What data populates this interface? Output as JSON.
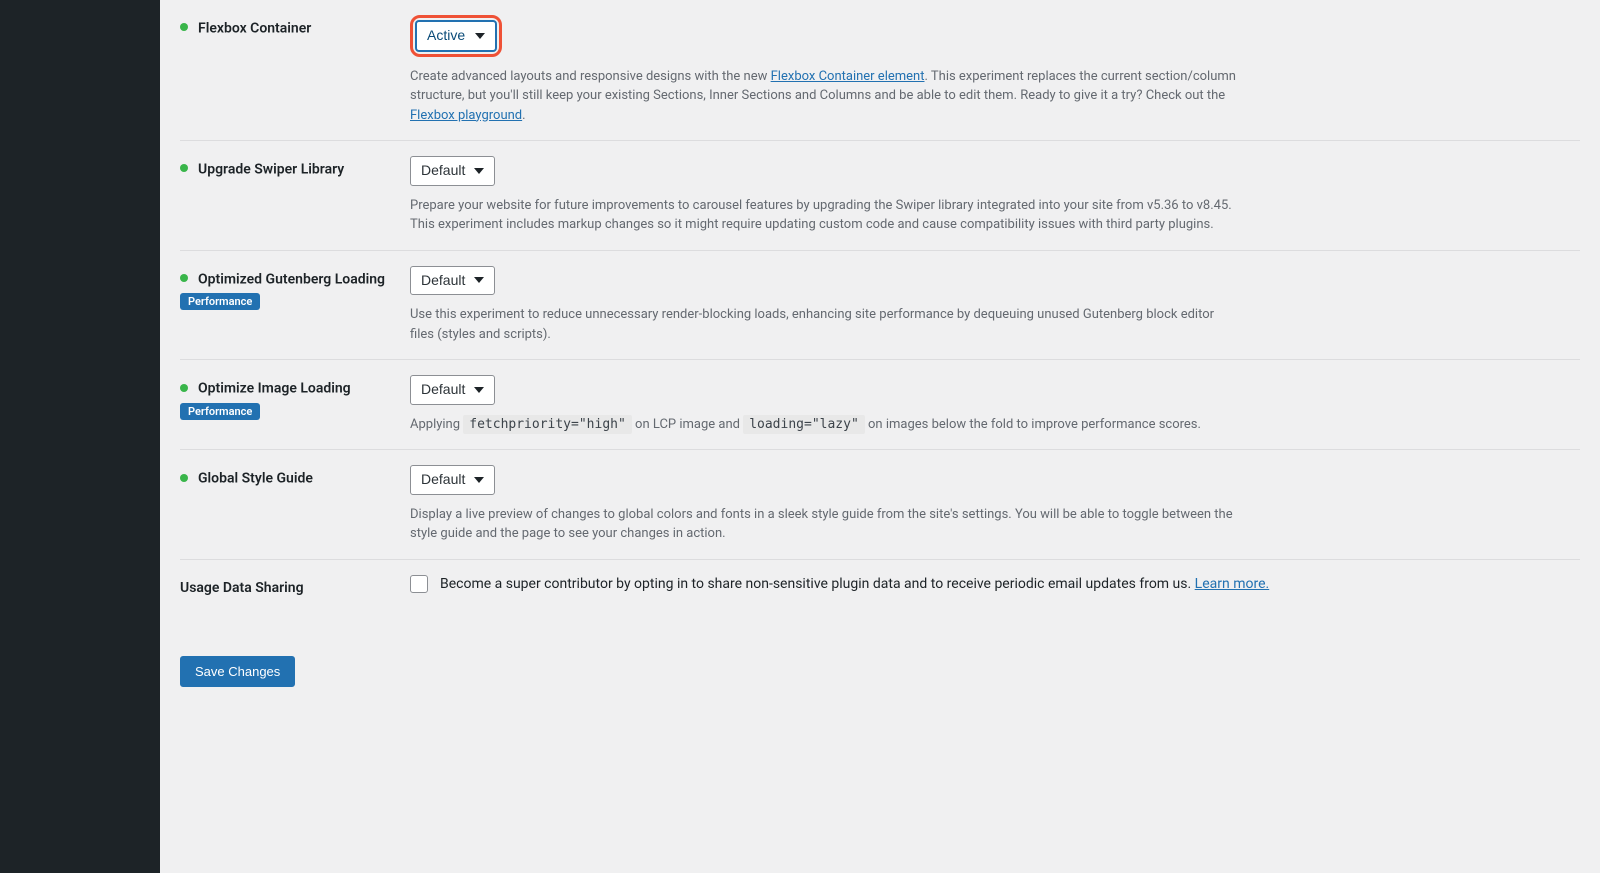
{
  "experiments": [
    {
      "title": "Flexbox Container",
      "select_value": "Active",
      "highlight": true,
      "tag": null,
      "desc_pre": "Create advanced layouts and responsive designs with the new ",
      "link1_text": "Flexbox Container element",
      "desc_mid": ". This experiment replaces the current section/column structure, but you'll still keep your existing Sections, Inner Sections and Columns and be able to edit them. Ready to give it a try? Check out the ",
      "link2_text": "Flexbox playground",
      "desc_post": "."
    },
    {
      "title": "Upgrade Swiper Library",
      "select_value": "Default",
      "tag": null,
      "desc_plain": "Prepare your website for future improvements to carousel features by upgrading the Swiper library integrated into your site from v5.36 to v8.45. This experiment includes markup changes so it might require updating custom code and cause compatibility issues with third party plugins."
    },
    {
      "title": "Optimized Gutenberg Loading",
      "select_value": "Default",
      "tag": "Performance",
      "desc_plain": "Use this experiment to reduce unnecessary render-blocking loads, enhancing site performance by dequeuing unused Gutenberg block editor files (styles and scripts)."
    },
    {
      "title": "Optimize Image Loading",
      "select_value": "Default",
      "tag": "Performance",
      "desc_code_pre": "Applying ",
      "code1": "fetchpriority=\"high\"",
      "desc_code_mid": " on LCP image and ",
      "code2": "loading=\"lazy\"",
      "desc_code_post": " on images below the fold to improve performance scores."
    },
    {
      "title": "Global Style Guide",
      "select_value": "Default",
      "tag": null,
      "desc_plain": "Display a live preview of changes to global colors and fonts in a sleek style guide from the site's settings. You will be able to toggle between the style guide and the page to see your changes in action."
    }
  ],
  "usage": {
    "title": "Usage Data Sharing",
    "label": "Become a super contributor by opting in to share non-sensitive plugin data and to receive periodic email updates from us. ",
    "learn_more": "Learn more."
  },
  "submit": {
    "save_label": "Save Changes"
  }
}
